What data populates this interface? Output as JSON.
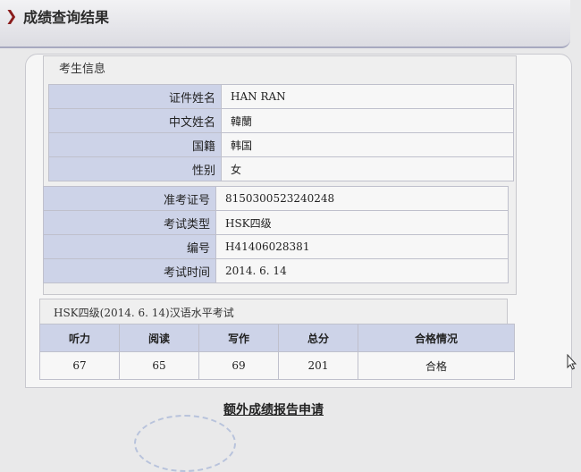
{
  "header": {
    "title": "成绩查询结果"
  },
  "candidate": {
    "caption": "考生信息",
    "rows_personal": [
      {
        "label": "证件姓名",
        "value": "HAN RAN"
      },
      {
        "label": "中文姓名",
        "value": "韓蘭"
      },
      {
        "label": "国籍",
        "value": "韩国"
      },
      {
        "label": "性别",
        "value": "女"
      }
    ],
    "rows_exam": [
      {
        "label": "准考证号",
        "value": "8150300523240248"
      },
      {
        "label": "考试类型",
        "value": "HSK四级"
      },
      {
        "label": "编号",
        "value": "H41406028381"
      },
      {
        "label": "考试时间",
        "value": "2014. 6. 14"
      }
    ]
  },
  "score": {
    "caption": "HSK四级(2014. 6. 14)汉语水平考试",
    "headers": [
      "听力",
      "阅读",
      "写作",
      "总分",
      "合格情况"
    ],
    "values": [
      "67",
      "65",
      "69",
      "201",
      "合格"
    ]
  },
  "footer": {
    "link_label": "额外成绩报告申请"
  },
  "colors": {
    "label_bg": "#cdd3e8",
    "header_border": "#a7a9c0",
    "arrow": "#8a1c1c"
  },
  "icons": {
    "header_arrow": "chevron-right-icon",
    "cursor": "mouse-cursor-icon"
  }
}
